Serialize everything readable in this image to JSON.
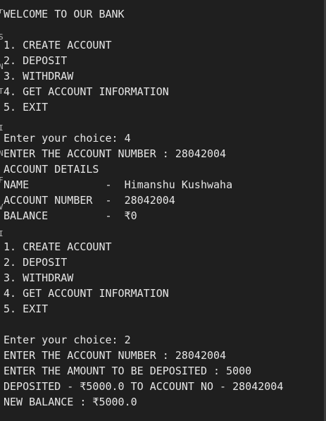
{
  "console": {
    "lines": [
      "WELCOME TO OUR BANK",
      "",
      "1. CREATE ACCOUNT",
      "2. DEPOSIT",
      "3. WITHDRAW",
      "4. GET ACCOUNT INFORMATION",
      "5. EXIT",
      "",
      "Enter your choice: 4",
      "ENTER THE ACCOUNT NUMBER : 28042004",
      "ACCOUNT DETAILS",
      "NAME            -  Himanshu Kushwaha",
      "ACCOUNT NUMBER  -  28042004",
      "BALANCE         -  ₹0",
      "",
      "1. CREATE ACCOUNT",
      "2. DEPOSIT",
      "3. WITHDRAW",
      "4. GET ACCOUNT INFORMATION",
      "5. EXIT",
      "",
      "Enter your choice: 2",
      "ENTER THE ACCOUNT NUMBER : 28042004",
      "ENTER THE AMOUNT TO BE DEPOSITED : 5000",
      "DEPOSITED - ₹5000.0 TO ACCOUNT NO - 28042004",
      "NEW BALANCE : ₹5000.0"
    ]
  },
  "gutter": {
    "marks": [
      "r",
      "S",
      "N",
      "T",
      "I",
      "N",
      "F",
      "V",
      "I"
    ]
  }
}
